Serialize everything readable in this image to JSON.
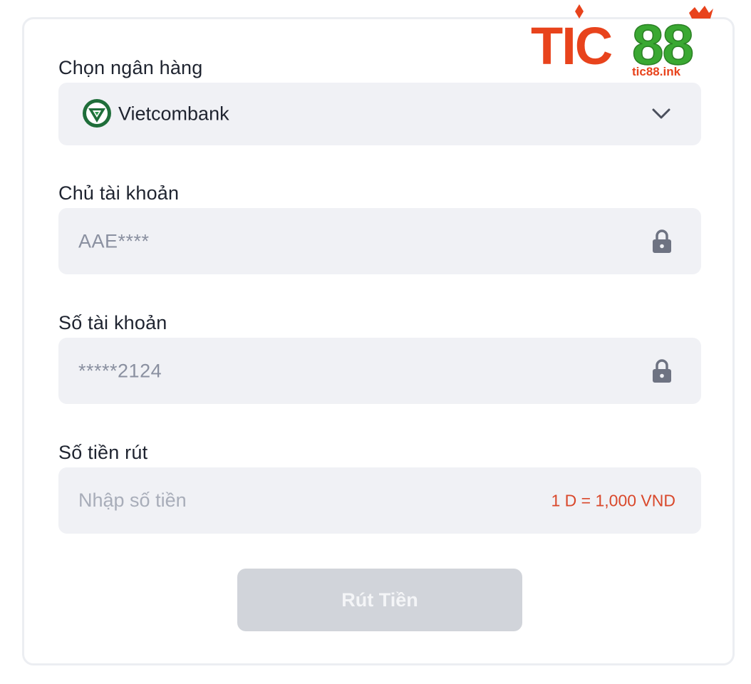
{
  "brand": {
    "logo_text": "TIC88",
    "logo_domain": "tic88.ink",
    "colors": {
      "red": "#e8431c",
      "green": "#3aa832"
    }
  },
  "form": {
    "bank": {
      "label": "Chọn ngân hàng",
      "selected": "Vietcombank",
      "icon": "vietcombank-logo",
      "dropdown_icon": "chevron-down-icon"
    },
    "holder": {
      "label": "Chủ tài khoản",
      "value": "AAE****",
      "icon": "lock-icon"
    },
    "account": {
      "label": "Số tài khoản",
      "value": "*****2124",
      "icon": "lock-icon"
    },
    "amount": {
      "label": "Số tiền rút",
      "placeholder": "Nhập số tiền",
      "rate": "1 D = 1,000 VND"
    },
    "submit_label": "Rút Tiền"
  },
  "colors": {
    "field_bg": "#f0f1f5",
    "rate_text": "#d9482b",
    "button_disabled": "#d1d4da"
  }
}
